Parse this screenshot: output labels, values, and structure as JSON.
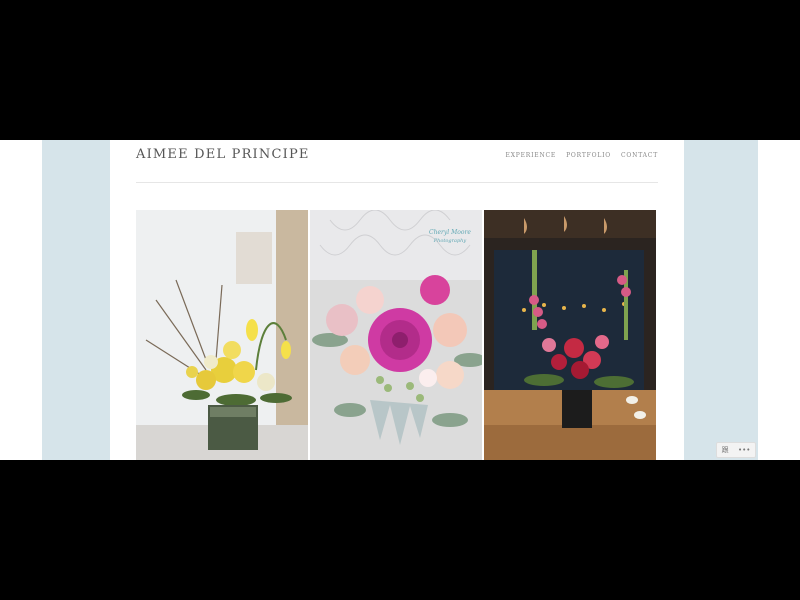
{
  "site": {
    "title": "AIMEE DEL PRINCIPE"
  },
  "nav": {
    "items": [
      {
        "label": "EXPERIENCE"
      },
      {
        "label": "PORTFOLIO"
      },
      {
        "label": "CONTACT"
      }
    ]
  },
  "gallery": {
    "images": [
      {
        "name": "yellow-tulip-arrangement"
      },
      {
        "name": "pink-dahlia-bouquet",
        "watermark": "Cheryl Moore Photography"
      },
      {
        "name": "red-rose-snapdragon-arrangement"
      }
    ]
  },
  "corner_toolbar": {
    "left_glyph": "跟",
    "right_glyph": "•••"
  },
  "colors": {
    "side_panel": "#d6e4ea",
    "letterbox": "#000000",
    "title_text": "#555555",
    "nav_text": "#888888"
  }
}
